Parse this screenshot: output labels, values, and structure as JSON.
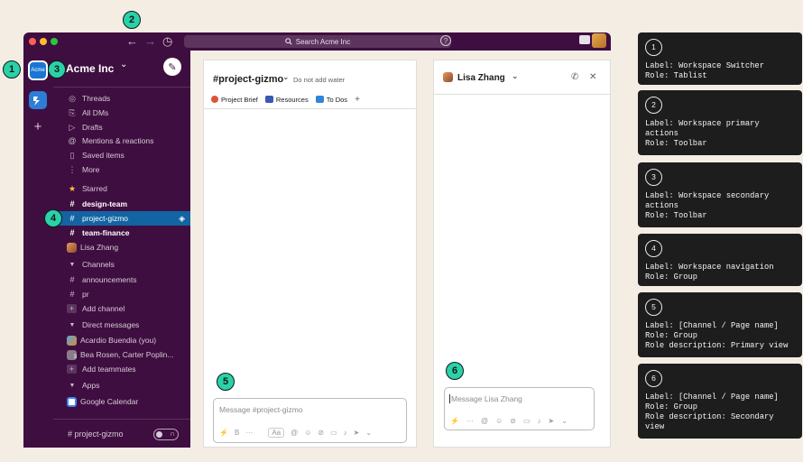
{
  "badges": [
    "1",
    "2",
    "3",
    "4",
    "5",
    "6"
  ],
  "titlebar": {
    "search_placeholder": "Search Acme Inc",
    "back_glyph": "←",
    "forward_glyph": "→",
    "history_glyph": "◷",
    "help_glyph": "?",
    "icons": [
      "back-arrow-icon",
      "forward-arrow-icon",
      "history-icon",
      "search-icon",
      "help-icon"
    ]
  },
  "rail": {
    "workspace_abbr": "Acme",
    "add_glyph": "+"
  },
  "workspace": {
    "name": "Acme Inc",
    "chevron": "⌄",
    "compose_glyph": "✎"
  },
  "sidebar": {
    "items": [
      {
        "icon": "◎",
        "label": "Threads"
      },
      {
        "icon": "⎘",
        "label": "All DMs"
      },
      {
        "icon": "▷",
        "label": "Drafts"
      },
      {
        "icon": "@",
        "label": "Mentions & reactions"
      },
      {
        "icon": "▯",
        "label": "Saved items"
      },
      {
        "icon": "⋮",
        "label": "More"
      }
    ],
    "starred_header": "Starred",
    "starred": [
      {
        "prefix": "#",
        "label": "design-team"
      },
      {
        "prefix": "#",
        "label": "project-gizmo"
      },
      {
        "prefix": "#",
        "label": "team-finance"
      },
      {
        "prefix": "",
        "label": "Lisa Zhang"
      }
    ],
    "channels_header": "Channels",
    "channels": [
      {
        "prefix": "#",
        "label": "announcements"
      },
      {
        "prefix": "#",
        "label": "pr"
      },
      {
        "prefix": "+",
        "label": "Add channel"
      }
    ],
    "dm_header": "Direct messages",
    "dms": [
      {
        "label": "Acardio Buendia (you)"
      },
      {
        "label": "Bea Rosen, Carter Poplin..."
      },
      {
        "label": "Add teammates"
      }
    ],
    "apps_header": "Apps",
    "apps": [
      {
        "label": "Google Calendar"
      }
    ],
    "footer_channel": "# project-gizmo",
    "dm_group_count": "3"
  },
  "primary": {
    "channel": "#project-gizmo",
    "chevron": "⌄",
    "topic": "Do not add water",
    "bookmarks": [
      "Project Brief",
      "Resources",
      "To Dos"
    ],
    "add_bookmark": "+",
    "composer_placeholder": "Message #project-gizmo",
    "tools": [
      "⚡",
      "B",
      "···",
      "Aa",
      "@",
      "☺",
      "⊘",
      "▭",
      "♪",
      "➤",
      "⌄"
    ]
  },
  "secondary": {
    "name": "Lisa Zhang",
    "chevron": "⌄",
    "call_glyph": "✆",
    "close_glyph": "✕",
    "composer_placeholder": "Message Lisa Zhang",
    "tools": [
      "⚡",
      "···",
      "@",
      "☺",
      "⊘",
      "▭",
      "♪",
      "➤",
      "⌄"
    ]
  },
  "annotations": [
    {
      "num": "1",
      "lines": [
        "Label: Workspace Switcher",
        "Role: Tablist"
      ]
    },
    {
      "num": "2",
      "lines": [
        "Label: Workspace primary actions",
        "Role: Toolbar"
      ]
    },
    {
      "num": "3",
      "lines": [
        "Label: Workspace secondary actions",
        "Role: Toolbar"
      ]
    },
    {
      "num": "4",
      "lines": [
        "Label: Workspace navigation",
        "Role: Group"
      ]
    },
    {
      "num": "5",
      "lines": [
        "Label: [Channel / Page name]",
        "Role: Group",
        "Role description: Primary view"
      ]
    },
    {
      "num": "6",
      "lines": [
        "Label: [Channel / Page name]",
        "Role: Group",
        "Role description: Secondary view"
      ]
    }
  ],
  "colors": {
    "aubergine": "#3f0e40",
    "active_blue": "#1264a3",
    "badge_green": "#2bd1a8",
    "background": "#f4ede4"
  }
}
